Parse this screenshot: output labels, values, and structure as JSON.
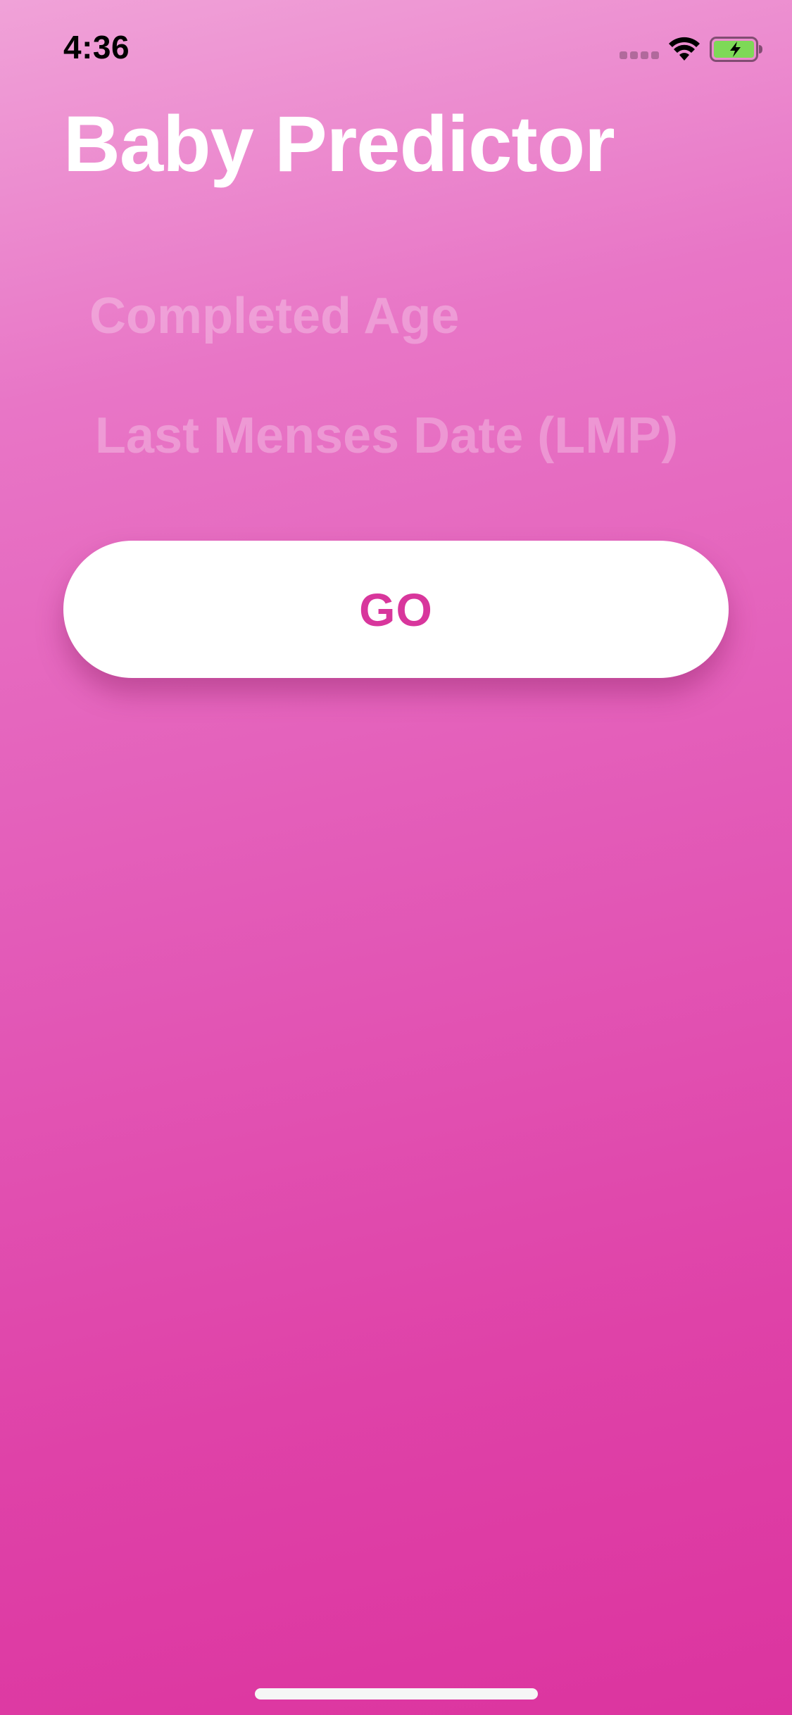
{
  "status_bar": {
    "time": "4:36"
  },
  "header": {
    "title": "Baby Predictor"
  },
  "form": {
    "age_placeholder": "Completed Age",
    "lmp_placeholder": "Last Menses Date (LMP)",
    "go_label": "GO"
  },
  "colors": {
    "gradient_top": "#f0a2d8",
    "gradient_bottom": "#dc349f",
    "button_background": "#ffffff",
    "button_text": "#d8369c",
    "battery_fill": "#7ed957"
  },
  "icons": {
    "signal": "cellular-signal-icon",
    "wifi": "wifi-icon",
    "battery": "battery-charging-icon"
  }
}
